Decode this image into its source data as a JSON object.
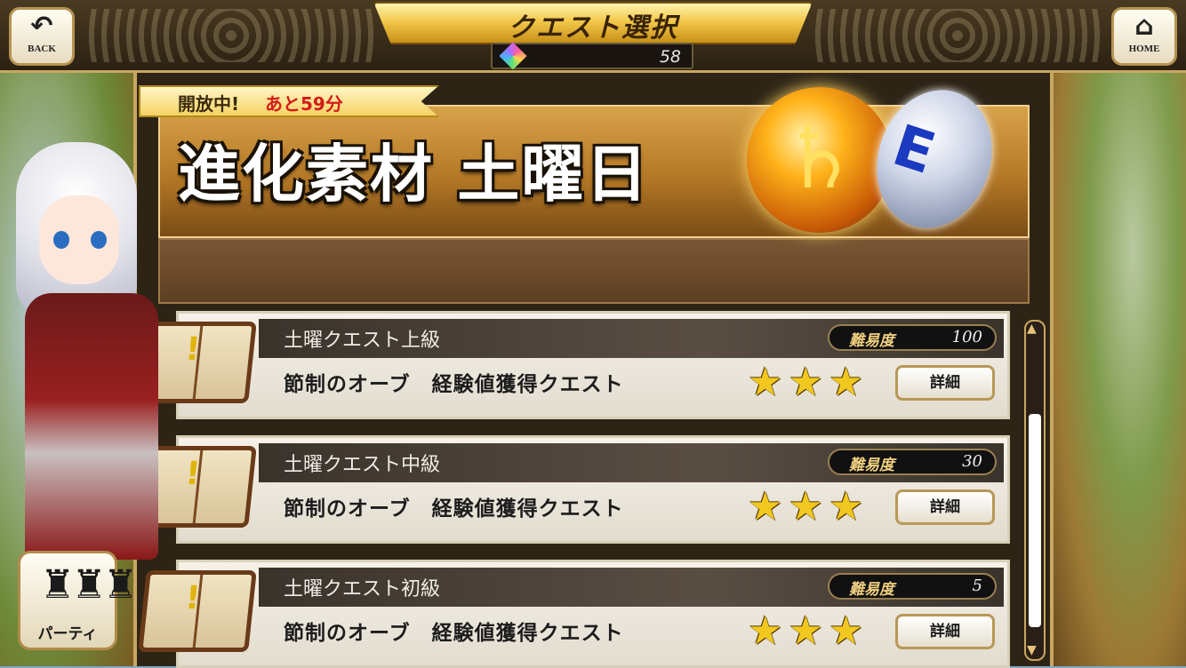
{
  "header": {
    "back_label": "BACK",
    "home_label": "HOME",
    "title": "クエスト選択",
    "gem_count": "58"
  },
  "event": {
    "status": "開放中!",
    "time_left": "あと59分",
    "title": "進化素材 土曜日",
    "orb_symbol": "♄",
    "egg_symbol": "E"
  },
  "quests": [
    {
      "name": "土曜クエスト上級",
      "difficulty_label": "難易度",
      "difficulty": "100",
      "description": "節制のオーブ　経験値獲得クエスト",
      "stars": 3,
      "detail_label": "詳細"
    },
    {
      "name": "土曜クエスト中級",
      "difficulty_label": "難易度",
      "difficulty": "30",
      "description": "節制のオーブ　経験値獲得クエスト",
      "stars": 3,
      "detail_label": "詳細"
    },
    {
      "name": "土曜クエスト初級",
      "difficulty_label": "難易度",
      "difficulty": "5",
      "description": "節制のオーブ　経験値獲得クエスト",
      "stars": 3,
      "detail_label": "詳細"
    }
  ],
  "party": {
    "label": "パーティ"
  },
  "icons": {
    "back": "back-arrow-icon",
    "home": "home-icon",
    "gem": "gem-icon",
    "party": "party-members-icon",
    "book": "quest-book-icon",
    "star": "star-icon"
  },
  "colors": {
    "gold": "#c9a760",
    "star": "#f0c820",
    "time_red": "#d41a1a"
  }
}
